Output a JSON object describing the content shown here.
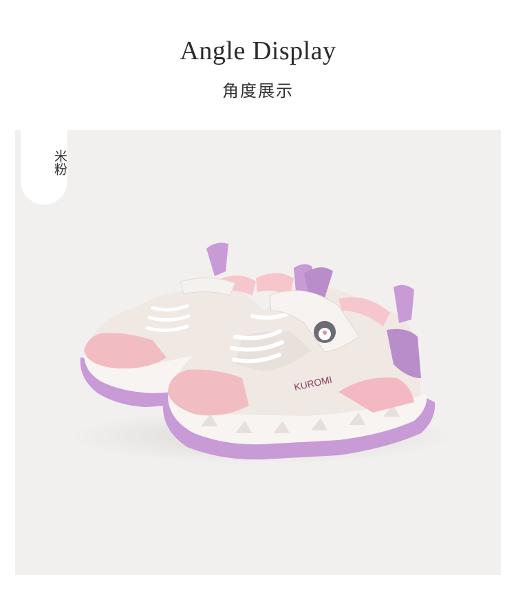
{
  "header": {
    "title": "Angle Display",
    "subtitle": "角度展示"
  },
  "color_tag": {
    "label": "米粉"
  },
  "product_photo": {
    "description_icon": "sneaker-pair-image",
    "logo_text": "KUROMI",
    "colors": {
      "background": "#f1f0ef",
      "upper": "#efe8e3",
      "pink": "#f2bcc3",
      "lilac": "#c89ad6",
      "sole": "#f7f4f2"
    }
  }
}
